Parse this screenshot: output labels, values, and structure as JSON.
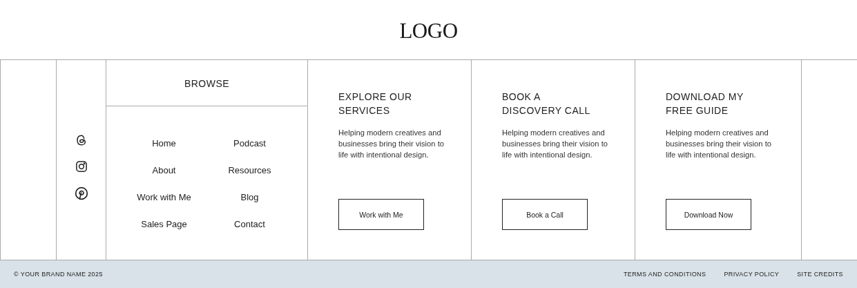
{
  "logo": "LOGO",
  "social": [
    {
      "kind": "threads"
    },
    {
      "kind": "instagram"
    },
    {
      "kind": "pinterest"
    }
  ],
  "browse": {
    "title": "BROWSE",
    "links": [
      "Home",
      "Podcast",
      "About",
      "Resources",
      "Work with Me",
      "Blog",
      "Sales Page",
      "Contact"
    ]
  },
  "cards": [
    {
      "title_lines": [
        "EXPLORE OUR",
        "SERVICES"
      ],
      "text": "Helping modern creatives and businesses bring their vision to life with intentional design.",
      "button": "Work with Me"
    },
    {
      "title_lines": [
        "BOOK A",
        "DISCOVERY CALL"
      ],
      "text": "Helping modern creatives and businesses bring their vision to life with intentional design.",
      "button": "Book a Call"
    },
    {
      "title_lines": [
        "DOWNLOAD MY",
        "FREE GUIDE"
      ],
      "text": "Helping modern creatives and businesses bring their vision to life with intentional design.",
      "button": "Download Now"
    }
  ],
  "bottom_bar": {
    "copyright": "© YOUR BRAND NAME 2025",
    "links": [
      "TERMS AND CONDITIONS",
      "PRIVACY POLICY",
      "SITE CREDITS"
    ]
  }
}
